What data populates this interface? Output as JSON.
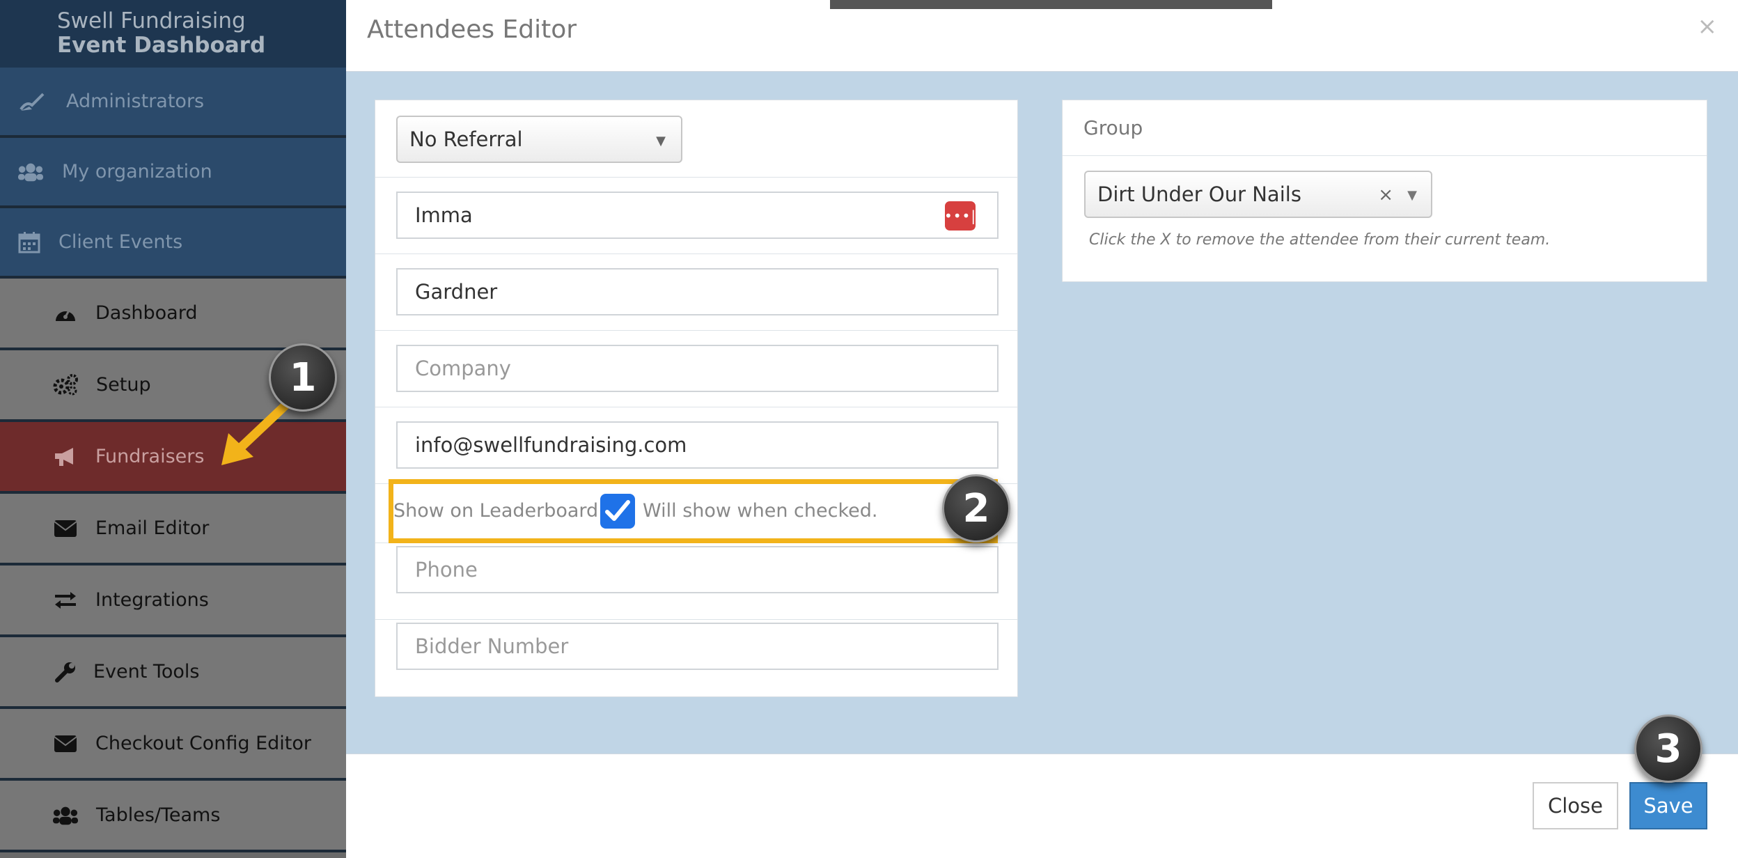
{
  "sidebar": {
    "brand_line1": "Swell Fundraising",
    "brand_line2": "Event Dashboard",
    "items": [
      {
        "label": "Administrators",
        "icon": "broom-icon"
      },
      {
        "label": "My organization",
        "icon": "users-icon"
      },
      {
        "label": "Client Events",
        "icon": "calendar-icon"
      },
      {
        "label": "Dashboard",
        "icon": "dashboard-icon"
      },
      {
        "label": "Setup",
        "icon": "gears-icon"
      },
      {
        "label": "Fundraisers",
        "icon": "bullhorn-icon"
      },
      {
        "label": "Email Editor",
        "icon": "envelope-icon"
      },
      {
        "label": "Integrations",
        "icon": "exchange-icon"
      },
      {
        "label": "Event Tools",
        "icon": "wrench-icon"
      },
      {
        "label": "Checkout Config Editor",
        "icon": "envelope-icon"
      },
      {
        "label": "Tables/Teams",
        "icon": "users-icon"
      }
    ]
  },
  "modal": {
    "title": "Attendees Editor",
    "close_x": "×",
    "referral": {
      "value": "No Referral",
      "caret": "▼"
    },
    "first_name": {
      "value": "Imma"
    },
    "last_name": {
      "value": "Gardner"
    },
    "company": {
      "placeholder": "Company"
    },
    "email": {
      "value": "info@swellfundraising.com"
    },
    "leaderboard": {
      "label": "Show on Leaderboard:",
      "checked": true,
      "help": "Will show when checked."
    },
    "phone": {
      "placeholder": "Phone"
    },
    "bidder": {
      "placeholder": "Bidder Number"
    },
    "group": {
      "header": "Group",
      "value": "Dirt Under Our Nails",
      "clear": "×",
      "caret": "▼",
      "hint": "Click the X to remove the attendee from their current team."
    },
    "footer": {
      "close_label": "Close",
      "save_label": "Save"
    }
  },
  "annotations": {
    "step1": "1",
    "step2": "2",
    "step3": "3"
  },
  "colors": {
    "highlight": "#f2b31a",
    "arrow": "#f2b31a",
    "save": "#3d8bd0",
    "active_nav": "#6e2b2b"
  }
}
